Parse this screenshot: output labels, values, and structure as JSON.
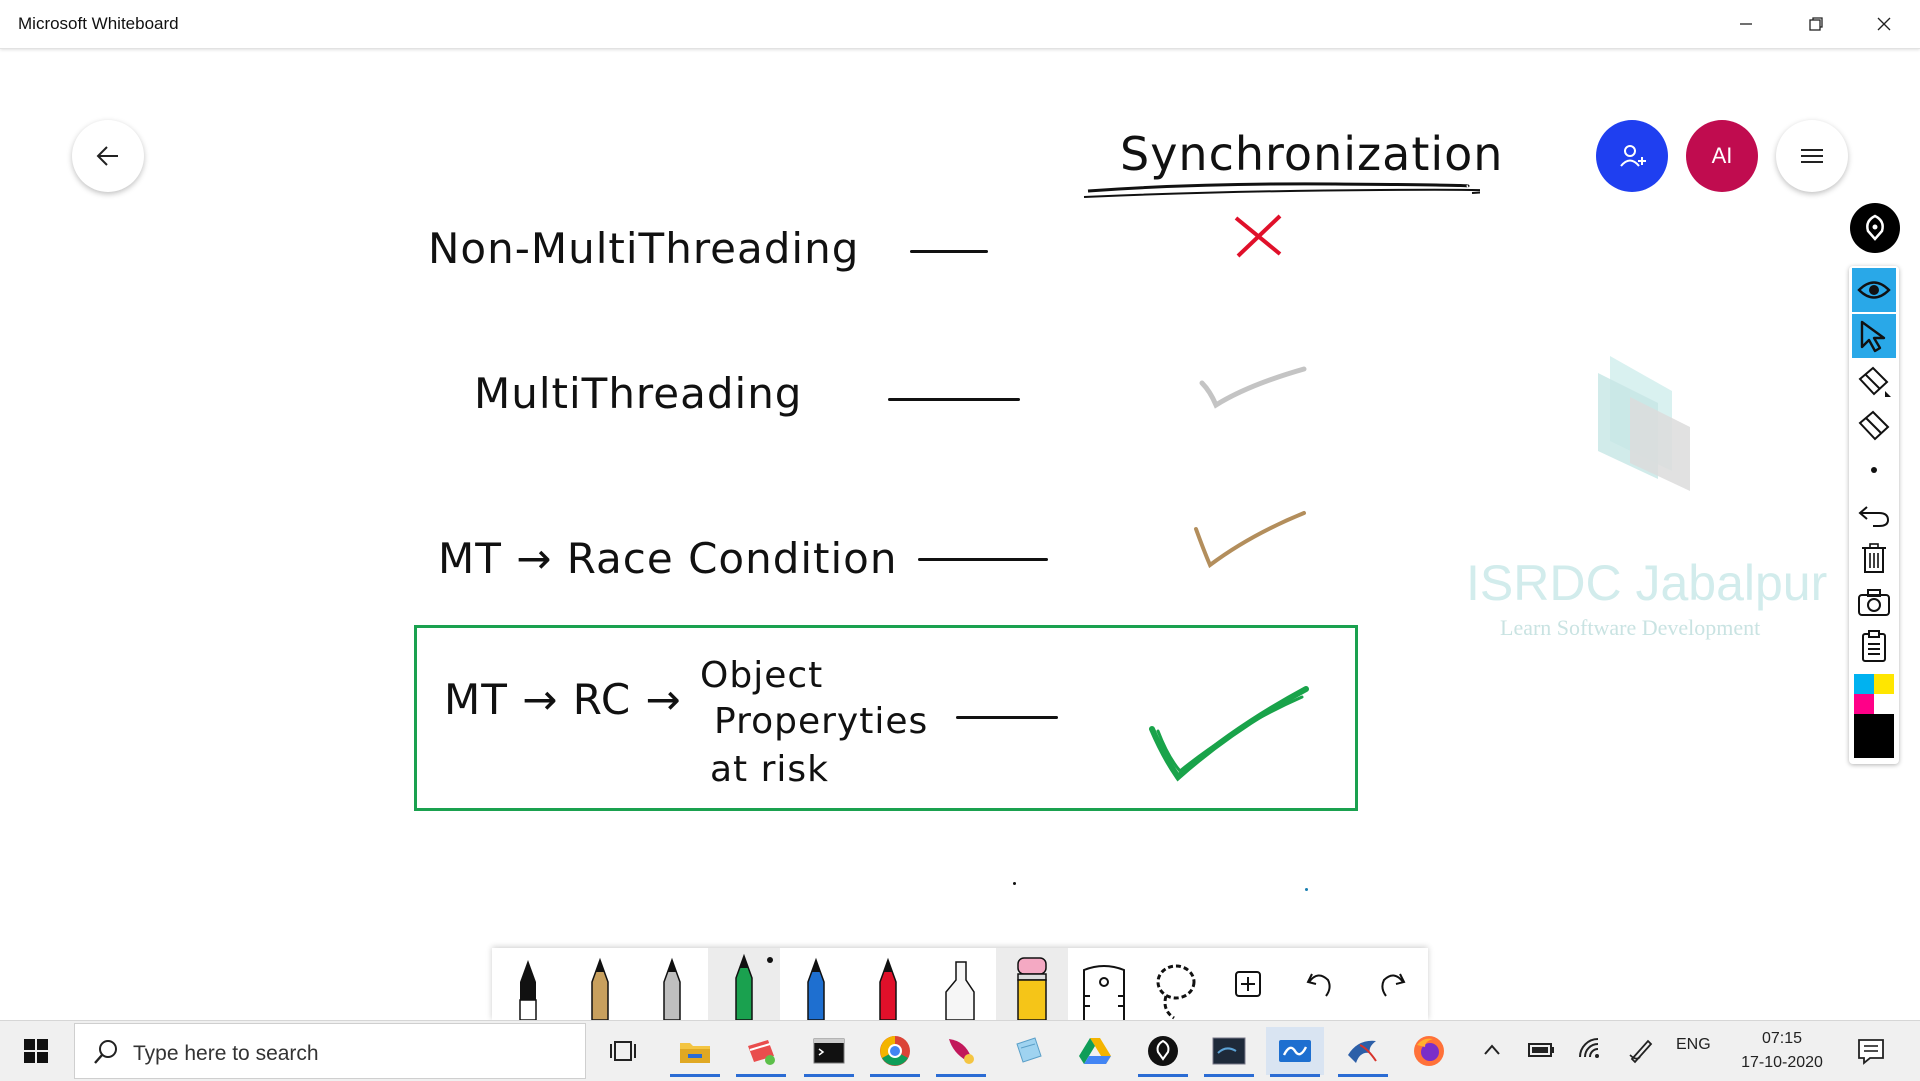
{
  "window": {
    "title": "Microsoft Whiteboard",
    "controls": [
      "minimize-icon",
      "restore-icon",
      "close-icon"
    ]
  },
  "header": {
    "back_icon": "arrow-left-icon",
    "invite_icon": "add-person-icon",
    "avatar_initials": "AI",
    "menu_icon": "hamburger-icon",
    "colors": {
      "invite": "#1f3ff0",
      "avatar": "#c00c4f"
    }
  },
  "board": {
    "title": "Synchronization",
    "rows": [
      {
        "label": "Non-MultiThreading",
        "mark": "cross-mark",
        "mark_color": "#e0102a"
      },
      {
        "label": "MultiThreading",
        "mark": "check-mark",
        "mark_color": "#c4c4c4"
      },
      {
        "label": "MT → Race Condition",
        "mark": "check-mark",
        "mark_color": "#b38e5c"
      }
    ],
    "highlight": {
      "prefix": "MT → RC →",
      "lines": [
        "Object",
        "Properyties",
        "at risk"
      ],
      "mark": "check-mark",
      "mark_color": "#19a34a",
      "frame_color": "#1aa14f"
    },
    "watermark": {
      "name": "ISRDC Jabalpur",
      "tagline": "Learn Software Development"
    }
  },
  "side_toolbar": {
    "tools": [
      "ink-icon",
      "view-icon",
      "select-icon",
      "ruler-eraser-icon",
      "eraser-icon",
      "dot-size-icon",
      "undo-icon",
      "trash-icon",
      "camera-icon",
      "clipboard-icon"
    ],
    "palette": [
      "#00b2f0",
      "#ffe600",
      "#ff0088",
      "#ffffff",
      "#000000"
    ]
  },
  "pen_toolbar": {
    "pens": [
      {
        "name": "black-pen",
        "color": "#111111"
      },
      {
        "name": "gold-pen",
        "color": "#c8a05e"
      },
      {
        "name": "silver-pen",
        "color": "#bfbfbf"
      },
      {
        "name": "green-pen",
        "color": "#1aa14f",
        "selected": true
      },
      {
        "name": "blue-pen",
        "color": "#1e6fd0"
      },
      {
        "name": "red-pen",
        "color": "#e0102a"
      },
      {
        "name": "highlighter",
        "color": "#f0f0f0"
      },
      {
        "name": "yellow-eraser-pencil",
        "color": "#f5c518",
        "tip": "#f4a9c3"
      }
    ],
    "tools": [
      "ruler-icon",
      "lasso-icon",
      "add-icon",
      "undo-icon",
      "redo-icon"
    ]
  },
  "taskbar": {
    "search_placeholder": "Type here to search",
    "apps": [
      "task-view-icon",
      "file-explorer-icon",
      "paint-icon",
      "terminal-icon",
      "chrome-icon",
      "feather-icon",
      "notepad-icon",
      "google-drive-icon",
      "ink-app-icon",
      "mysql-icon",
      "whiteboard-icon",
      "bird-icon",
      "firefox-icon"
    ],
    "tray": {
      "language": "ENG",
      "time": "07:15",
      "date": "17-10-2020"
    }
  }
}
